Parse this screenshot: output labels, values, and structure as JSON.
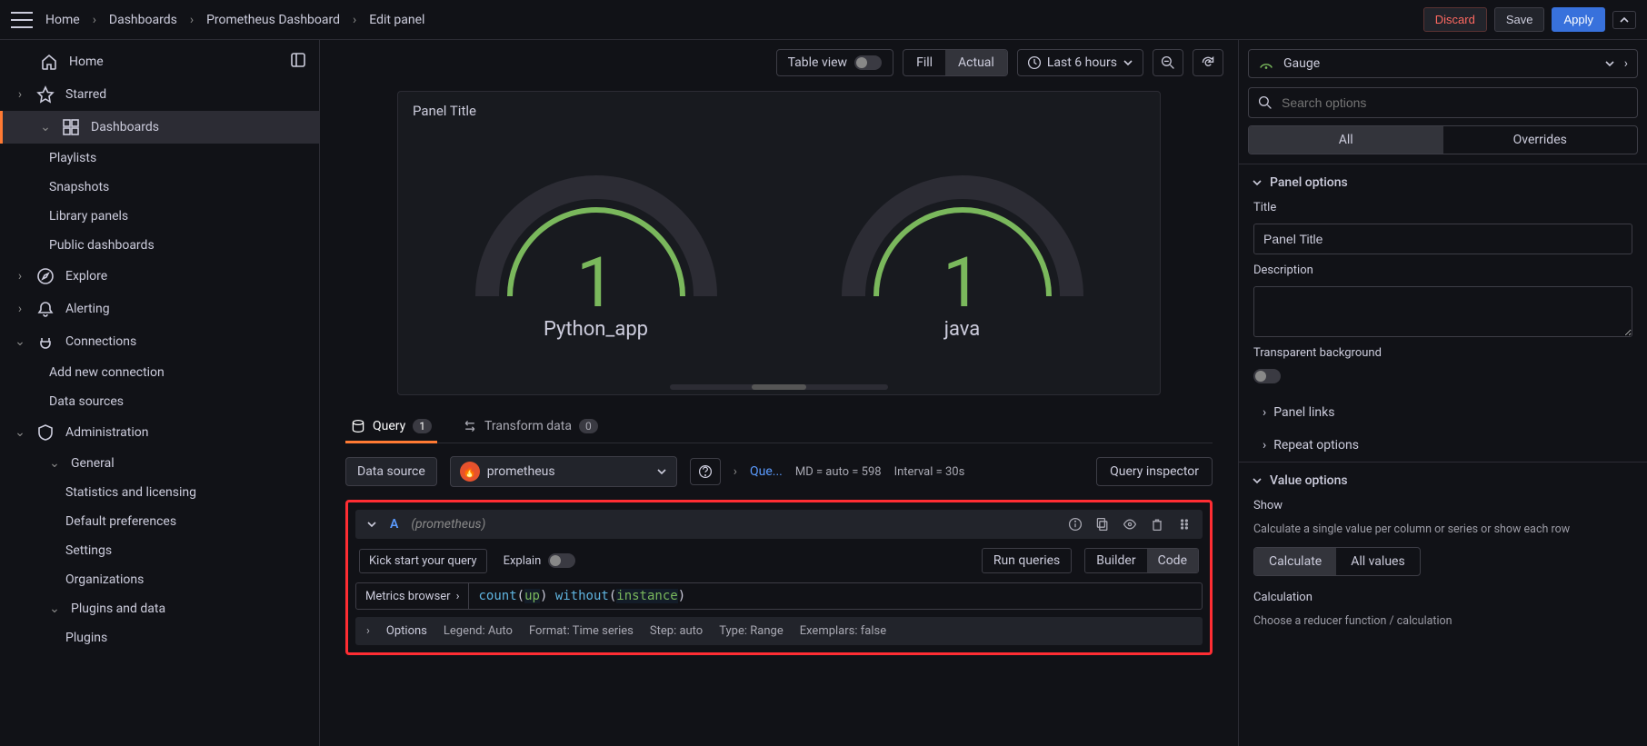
{
  "breadcrumbs": [
    "Home",
    "Dashboards",
    "Prometheus Dashboard",
    "Edit panel"
  ],
  "topActions": {
    "discard": "Discard",
    "save": "Save",
    "apply": "Apply"
  },
  "sidebar": {
    "home": "Home",
    "starred": "Starred",
    "dashboards": "Dashboards",
    "playlists": "Playlists",
    "snapshots": "Snapshots",
    "libraryPanels": "Library panels",
    "publicDashboards": "Public dashboards",
    "explore": "Explore",
    "alerting": "Alerting",
    "connections": "Connections",
    "addConnection": "Add new connection",
    "dataSources": "Data sources",
    "administration": "Administration",
    "general": "General",
    "statsLicensing": "Statistics and licensing",
    "defaultPrefs": "Default preferences",
    "settings": "Settings",
    "organizations": "Organizations",
    "pluginsData": "Plugins and data",
    "plugins": "Plugins"
  },
  "toolbar": {
    "tableView": "Table view",
    "fill": "Fill",
    "actual": "Actual",
    "timeRange": "Last 6 hours"
  },
  "panel": {
    "title": "Panel Title",
    "gauges": [
      {
        "value": "1",
        "label": "Python_app"
      },
      {
        "value": "1",
        "label": "java"
      }
    ]
  },
  "tabs": {
    "query": "Query",
    "queryCount": "1",
    "transform": "Transform data",
    "transformCount": "0"
  },
  "datasource": {
    "label": "Data source",
    "selected": "prometheus",
    "queShort": "Que...",
    "md": "MD = auto = 598",
    "interval": "Interval = 30s",
    "inspector": "Query inspector"
  },
  "queryRow": {
    "letter": "A",
    "dsHint": "(prometheus)",
    "kick": "Kick start your query",
    "explain": "Explain",
    "run": "Run queries",
    "builder": "Builder",
    "code": "Code",
    "metricsBrowser": "Metrics browser",
    "expression": {
      "fn": "count",
      "arg": "up",
      "kw": "without",
      "arg2": "instance"
    },
    "options": "Options",
    "legend": "Legend: Auto",
    "format": "Format: Time series",
    "step": "Step: auto",
    "type": "Type: Range",
    "exemplars": "Exemplars: false"
  },
  "rightPanel": {
    "vizName": "Gauge",
    "searchPlaceholder": "Search options",
    "all": "All",
    "overrides": "Overrides",
    "panelOptions": "Panel options",
    "titleLabel": "Title",
    "titleValue": "Panel Title",
    "descriptionLabel": "Description",
    "transparentBg": "Transparent background",
    "panelLinks": "Panel links",
    "repeatOptions": "Repeat options",
    "valueOptions": "Value options",
    "show": "Show",
    "showDesc": "Calculate a single value per column or series or show each row",
    "calculate": "Calculate",
    "allValues": "All values",
    "calculation": "Calculation",
    "calculationDesc": "Choose a reducer function / calculation"
  }
}
